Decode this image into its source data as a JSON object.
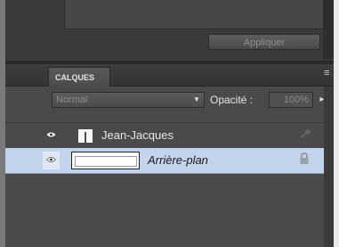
{
  "apply_label": "Appliquer",
  "layers_panel": {
    "tab_label": "CALQUES",
    "menu_glyph": "≡",
    "blend_mode": "Normal",
    "opacity_label": "Opacité :",
    "opacity_value": "100%",
    "layers": [
      {
        "name": "Jean-Jacques",
        "visible": true,
        "selected": false
      },
      {
        "name": "Arrière-plan",
        "visible": true,
        "selected": true,
        "locked": true
      }
    ]
  }
}
